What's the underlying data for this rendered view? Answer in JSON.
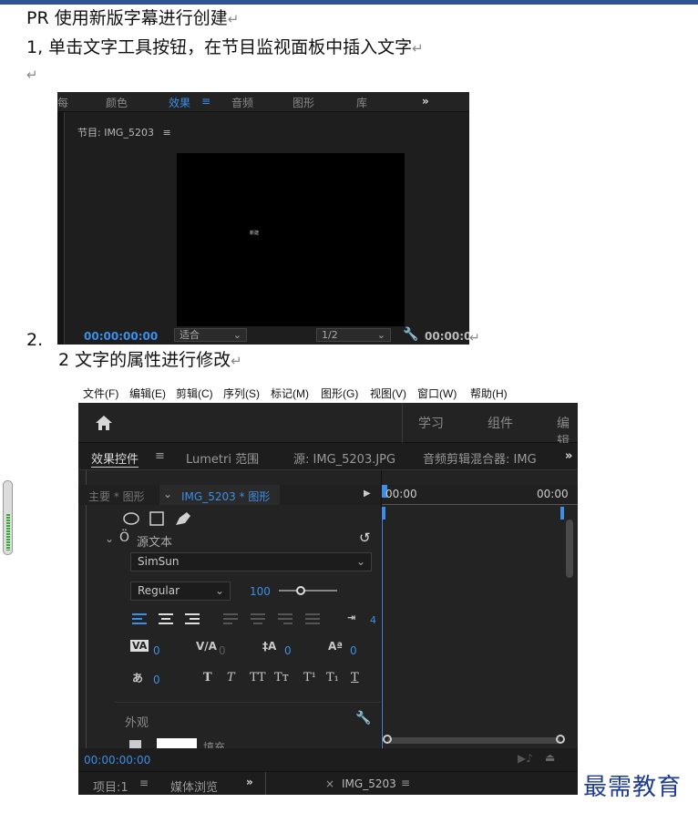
{
  "doc": {
    "title": "PR 使用新版字幕进行创建",
    "step1": "1,  单击文字工具按钮，在节目监视面板中插入文字",
    "step2_num": "2.",
    "step2": "2 文字的属性进行修改",
    "return_mark": "↵",
    "brand": "最需教育"
  },
  "shot1": {
    "tabs": [
      "颜色",
      "效果",
      "音频",
      "图形",
      "库"
    ],
    "tab_partial": "每",
    "active_tab": "效果",
    "more": "»",
    "monitor_label": "节目: IMG_5203",
    "timecode_left": "00:00:00:00",
    "fit": "适合",
    "ratio": "1/2",
    "timecode_right": "00:00:0",
    "tiny_text": "新建"
  },
  "shot2": {
    "menu": [
      "文件(F)",
      "编辑(E)",
      "剪辑(C)",
      "序列(S)",
      "标记(M)",
      "图形(G)",
      "视图(V)",
      "窗口(W)",
      "帮助(H)"
    ],
    "header_tabs": [
      "学习",
      "组件",
      "编辑"
    ],
    "panel_tabs": [
      "效果控件",
      "Lumetri 范围",
      "源: IMG_5203.JPG",
      "音频剪辑混合器: IMG"
    ],
    "master": "主要 * 图形",
    "clip": "IMG_5203 * 图形",
    "time_start": "00:00",
    "time_end": "00:00",
    "source_text": "源文本",
    "font": "SimSun",
    "style": "Regular",
    "size": "100",
    "tracking_value": "0",
    "kerning_value": "0",
    "leading_value": "0",
    "baseline_value": "0",
    "tsume_value": "0",
    "tab_value": "4",
    "typo_buttons": [
      "T",
      "T",
      "TT",
      "Tт",
      "T¹",
      "T₁",
      "T"
    ],
    "appearance": "外观",
    "fill": "填充",
    "timecode": "00:00:00:00",
    "bottom_tabs": [
      "项目:1",
      "媒体浏览",
      "IMG_5203"
    ]
  }
}
